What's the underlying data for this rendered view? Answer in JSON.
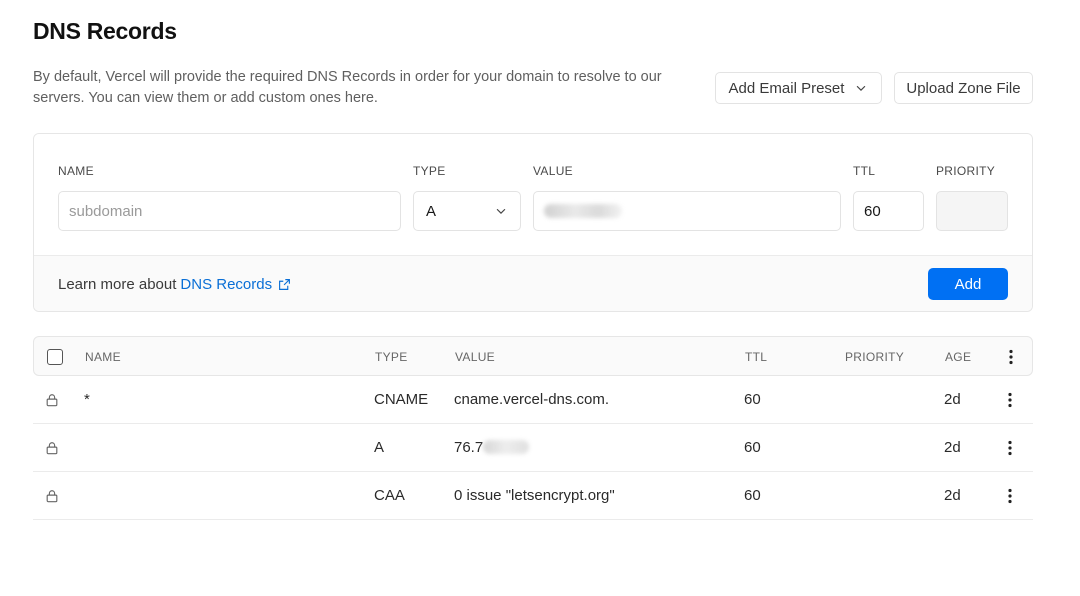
{
  "page": {
    "title": "DNS Records",
    "description": "By default, Vercel will provide the required DNS Records in order for your domain to resolve to our servers. You can view them or add custom ones here."
  },
  "actions": {
    "email_preset": "Add Email Preset",
    "upload_zone": "Upload Zone File"
  },
  "form": {
    "labels": {
      "name": "NAME",
      "type": "TYPE",
      "value": "VALUE",
      "ttl": "TTL",
      "priority": "PRIORITY"
    },
    "name_placeholder": "subdomain",
    "type_value": "A",
    "ttl_value": "60",
    "learn_prefix": "Learn more about",
    "learn_link": "DNS Records",
    "add_label": "Add"
  },
  "table": {
    "headers": {
      "name": "NAME",
      "type": "TYPE",
      "value": "VALUE",
      "ttl": "TTL",
      "priority": "PRIORITY",
      "age": "AGE"
    },
    "rows": [
      {
        "name": "*",
        "type": "CNAME",
        "value": "cname.vercel-dns.com.",
        "ttl": "60",
        "priority": "",
        "age": "2d"
      },
      {
        "name": "",
        "type": "A",
        "value": "76.7",
        "ttl": "60",
        "priority": "",
        "age": "2d"
      },
      {
        "name": "",
        "type": "CAA",
        "value": "0 issue \"letsencrypt.org\"",
        "ttl": "60",
        "priority": "",
        "age": "2d"
      }
    ]
  },
  "icons": {
    "dropdown": "chevron-down-icon",
    "external": "external-link-icon",
    "lock": "lock-icon",
    "more": "more-vertical-icon"
  },
  "colors": {
    "primary": "#0070f3",
    "link": "#0a6fd6"
  }
}
